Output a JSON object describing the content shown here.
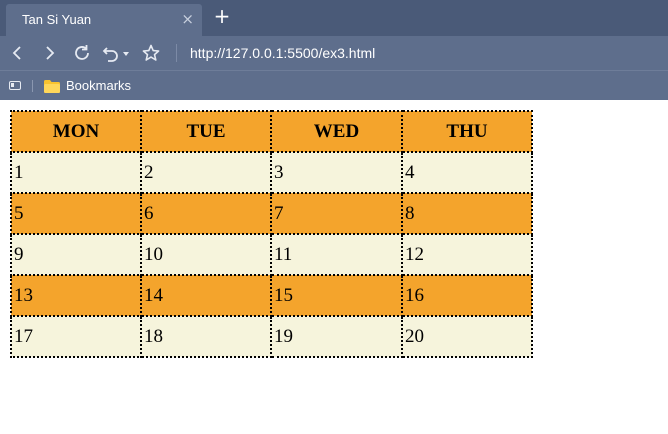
{
  "browser": {
    "tab_title": "Tan Si Yuan",
    "tab_close_glyph": "×",
    "new_tab_glyph": "+",
    "address": "http://127.0.0.1:5500/ex3.html",
    "bookmarks_label": "Bookmarks",
    "icons": [
      "back-icon",
      "forward-icon",
      "reload-icon",
      "undo-icon",
      "star-icon",
      "sidebar-icon",
      "folder-icon"
    ]
  },
  "calendar": {
    "headers": [
      "MON",
      "TUE",
      "WED",
      "THU"
    ],
    "rows": [
      [
        "1",
        "2",
        "3",
        "4"
      ],
      [
        "5",
        "6",
        "7",
        "8"
      ],
      [
        "9",
        "10",
        "11",
        "12"
      ],
      [
        "13",
        "14",
        "15",
        "16"
      ],
      [
        "17",
        "18",
        "19",
        "20"
      ]
    ],
    "colors": {
      "header": "#f4a42c",
      "orange_row": "#f4a42c",
      "cream_row": "#f6f4dc",
      "border": "#000000"
    }
  }
}
